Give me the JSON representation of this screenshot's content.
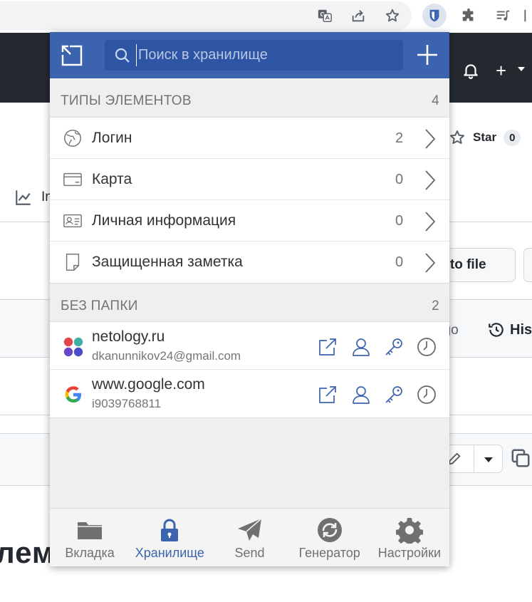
{
  "search": {
    "placeholder": "Поиск в хранилище"
  },
  "types_section": {
    "title": "ТИПЫ ЭЛЕМЕНТОВ",
    "count": "4"
  },
  "types": [
    {
      "label": "Логин",
      "count": "2",
      "icon": "globe-icon"
    },
    {
      "label": "Карта",
      "count": "0",
      "icon": "credit-card-icon"
    },
    {
      "label": "Личная информация",
      "count": "0",
      "icon": "id-card-icon"
    },
    {
      "label": "Защищенная заметка",
      "count": "0",
      "icon": "note-icon"
    }
  ],
  "folder_section": {
    "title": "БЕЗ ПАПКИ",
    "count": "2"
  },
  "items": [
    {
      "name": "netology.ru",
      "username": "dkanunnikov24@gmail.com",
      "icon": "netology-favicon"
    },
    {
      "name": "www.google.com",
      "username": "i9039768811",
      "icon": "google-favicon"
    }
  ],
  "tabs": [
    {
      "label": "Вкладка",
      "icon": "folder-icon",
      "active": false
    },
    {
      "label": "Хранилище",
      "icon": "lock-icon",
      "active": true
    },
    {
      "label": "Send",
      "icon": "send-icon",
      "active": false
    },
    {
      "label": "Генератор",
      "icon": "refresh-icon",
      "active": false
    },
    {
      "label": "Настройки",
      "icon": "gear-icon",
      "active": false
    }
  ],
  "background_page": {
    "star_label": "Star",
    "star_count": "0",
    "insights_label": "In",
    "go_to_file_label": "o to file",
    "ago_text": "ago",
    "history_label": "His",
    "heading_fragment": "лем"
  },
  "colors": {
    "accent": "#3c64ae",
    "header_dark": "#24292f",
    "icon_blue": "#3c64ae"
  }
}
